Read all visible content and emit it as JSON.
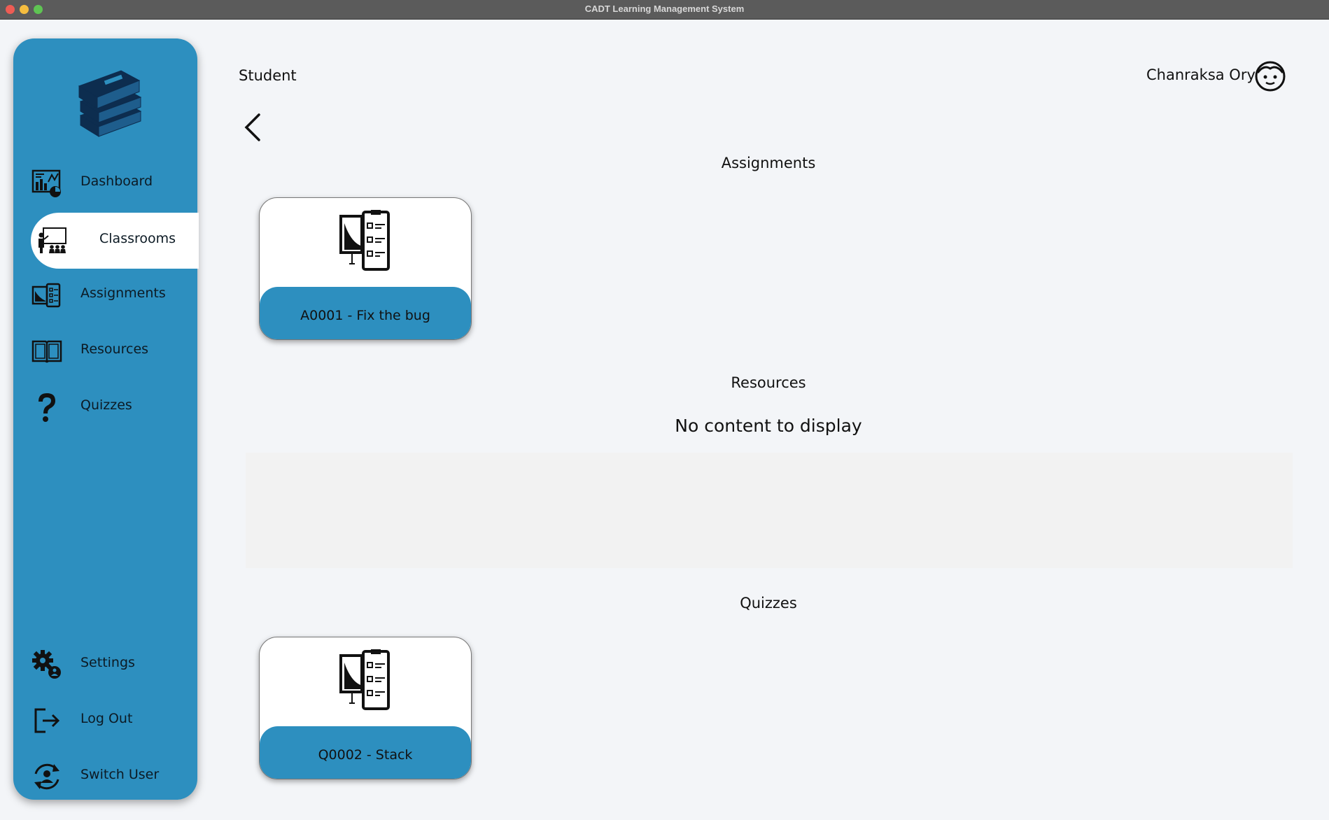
{
  "window": {
    "title": "CADT Learning Management System"
  },
  "sidebar": {
    "logo_icon": "books-stack-icon",
    "items": [
      {
        "label": "Dashboard",
        "icon": "dashboard-chart-icon"
      },
      {
        "label": "Classrooms",
        "icon": "classroom-teacher-icon",
        "active": true
      },
      {
        "label": "Assignments",
        "icon": "assignment-clipboard-icon"
      },
      {
        "label": "Resources",
        "icon": "open-book-icon"
      },
      {
        "label": "Quizzes",
        "icon": "question-mark-icon"
      }
    ],
    "bottom_items": [
      {
        "label": "Settings",
        "icon": "gears-icon"
      },
      {
        "label": "Log Out",
        "icon": "logout-icon"
      },
      {
        "label": "Switch User",
        "icon": "switch-user-icon"
      }
    ],
    "color": "#2d8fbf"
  },
  "header": {
    "role": "Student",
    "username": "Chanraksa Ory",
    "avatar_icon": "face-avatar-icon"
  },
  "sections": {
    "assignments": {
      "title": "Assignments",
      "cards": [
        {
          "label": "A0001 - Fix the bug",
          "icon": "assignment-clipboard-icon"
        }
      ]
    },
    "resources": {
      "title": "Resources",
      "empty_message": "No content to display"
    },
    "quizzes": {
      "title": "Quizzes",
      "cards": [
        {
          "label": "Q0002 - Stack",
          "icon": "assignment-clipboard-icon"
        }
      ]
    }
  }
}
